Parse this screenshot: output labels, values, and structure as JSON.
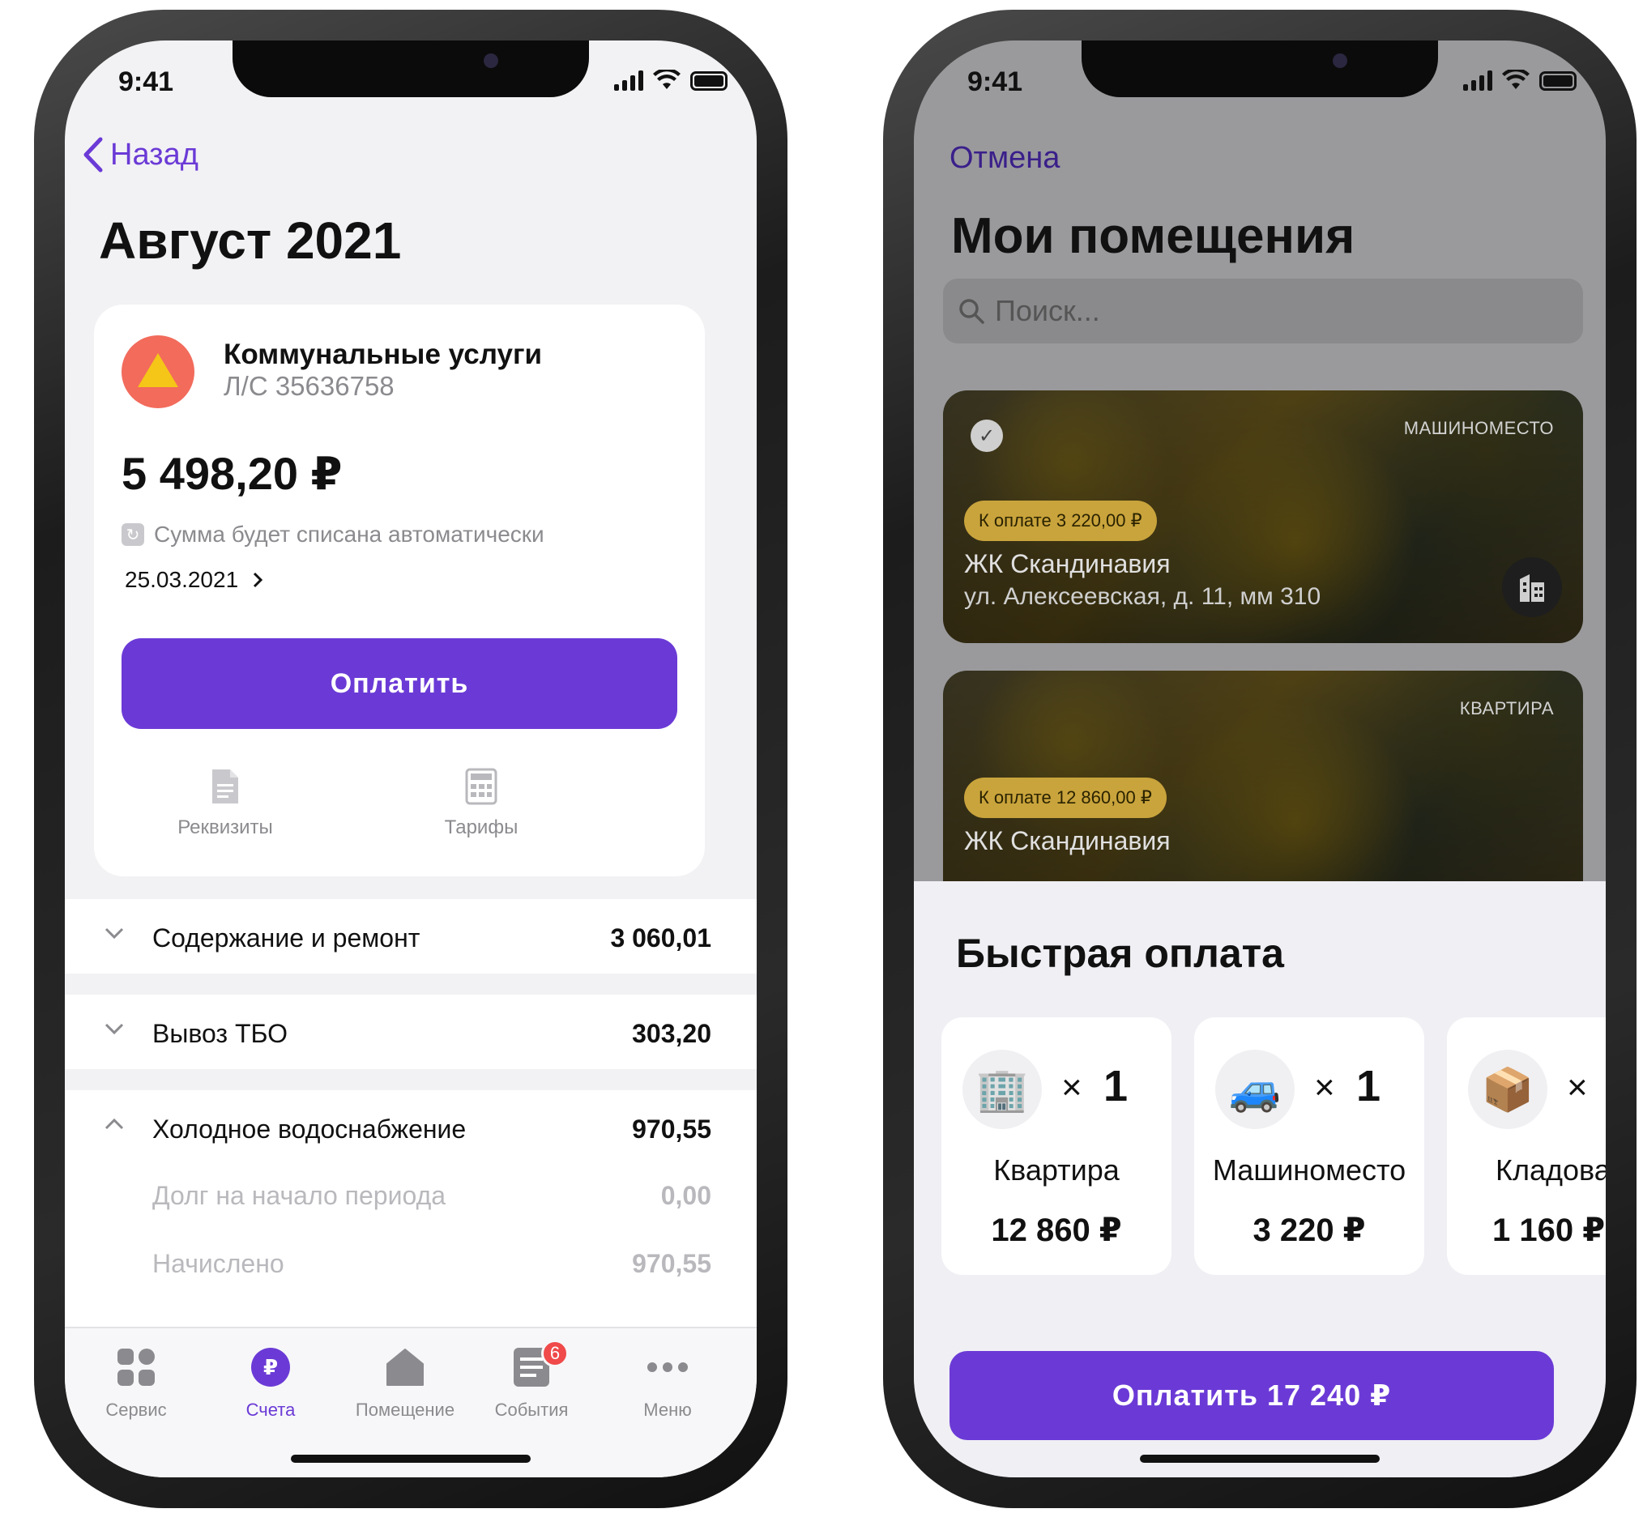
{
  "status": {
    "time": "9:41"
  },
  "left": {
    "back_label": "Назад",
    "title": "Август 2021",
    "card": {
      "title": "Коммунальные услуги",
      "account": "Л/С 35636758",
      "amount": "5 498,20 ₽",
      "auto_note": "Сумма будет списана автоматически",
      "date": "25.03.2021",
      "pay_label": "Оплатить",
      "actions": [
        {
          "label": "Реквизиты",
          "icon": "document-icon"
        },
        {
          "label": "Тарифы",
          "icon": "calculator-icon"
        }
      ]
    },
    "rows": [
      {
        "label": "Содержание и ремонт",
        "value": "3 060,01",
        "expanded": false
      },
      {
        "label": "Вывоз ТБО",
        "value": "303,20",
        "expanded": false
      },
      {
        "label": "Холодное водоснабжение",
        "value": "970,55",
        "expanded": true
      }
    ],
    "subrows": [
      {
        "label": "Долг на начало периода",
        "value": "0,00"
      },
      {
        "label": "Начислено",
        "value": "970,55"
      }
    ],
    "tabs": [
      {
        "label": "Сервис",
        "icon": "grid-icon"
      },
      {
        "label": "Счета",
        "icon": "ruble-icon",
        "active": true
      },
      {
        "label": "Помещение",
        "icon": "house-icon"
      },
      {
        "label": "События",
        "icon": "list-icon",
        "badge": "6"
      },
      {
        "label": "Меню",
        "icon": "more-icon"
      }
    ]
  },
  "right": {
    "cancel_label": "Отмена",
    "title": "Мои помещения",
    "search_placeholder": "Поиск...",
    "properties": [
      {
        "type": "МАШИНОМЕСТО",
        "due": "К оплате 3 220,00 ₽",
        "name": "ЖК Скандинавия",
        "address": "ул. Алексеевская, д. 11, мм 310",
        "selected": true
      },
      {
        "type": "КВАРТИРА",
        "due": "К оплате 12 860,00 ₽",
        "name": "ЖК Скандинавия"
      }
    ],
    "quick_title": "Быстрая оплата",
    "quick_items": [
      {
        "icon": "building-icon",
        "glyph": "🏢",
        "mult": "×",
        "count": "1",
        "label": "Квартира",
        "price": "12 860 ₽"
      },
      {
        "icon": "car-icon",
        "glyph": "🚙",
        "mult": "×",
        "count": "1",
        "label": "Машиноместо",
        "price": "3 220 ₽"
      },
      {
        "icon": "package-icon",
        "glyph": "📦",
        "mult": "×",
        "count": "",
        "label": "Кладовая",
        "price": "1 160 ₽"
      }
    ],
    "pay_label": "Оплатить 17 240 ₽"
  },
  "colors": {
    "accent": "#6b3ad6",
    "badge": "#f04a4a",
    "chip": "#c9a43c",
    "logo": "#f26b5b"
  }
}
